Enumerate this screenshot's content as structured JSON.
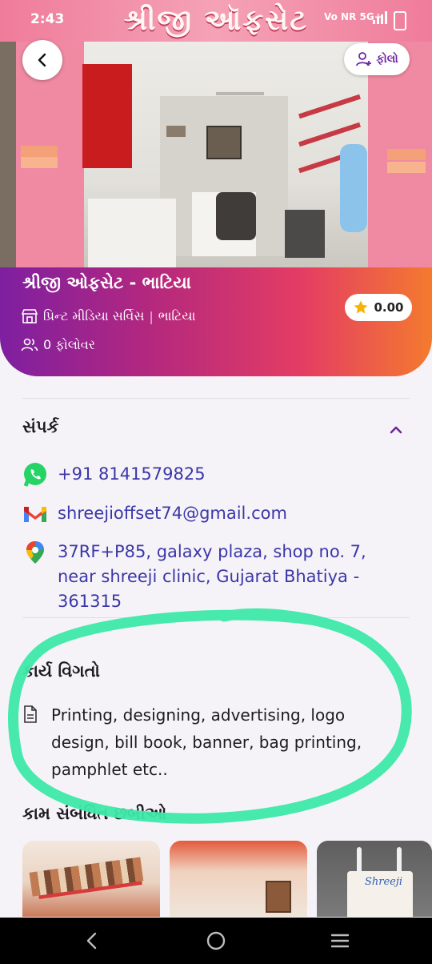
{
  "status_bar": {
    "time": "2:43",
    "network": "5G+",
    "carrier_labels": "Vo NR"
  },
  "hero": {
    "sign_text": "શ્રીજી ઑફસેટ",
    "follow_label": "ફોલો",
    "shop_name": "શ્રીજી ઓફસેટ - ભાટિયા",
    "category": "પ્રિન્ટ મીડિયા સર્વિસ",
    "location": "ભાટિયા",
    "followers": "0 ફોલોવર",
    "rating": "0.00"
  },
  "contact": {
    "title": "સંપર્ક",
    "phone": "+91 8141579825",
    "email": "shreejioffset74@gmail.com",
    "address_line1": "37RF+P85, galaxy plaza, shop no. 7,",
    "address_line2": "near shreeji clinic,  Gujarat Bhatiya -",
    "address_line3": "361315"
  },
  "work_details": {
    "title": "કાર્ય વિગતો",
    "description_line1": "Printing, designing, advertising, logo",
    "description_line2": "design, bill book, banner, bag printing,",
    "description_line3": "pamphlet etc.."
  },
  "gallery": {
    "title": "કામ સંબંધિત છબીઓ",
    "thumb3_label": "Shreeji"
  },
  "colors": {
    "primary_purple": "#7e1fa1",
    "accent_orange": "#f47a2e",
    "link_blue": "#3a37a8",
    "highlight_green": "#3de8a8"
  },
  "icons": {
    "back": "arrow-left-icon",
    "follow": "add-user-icon",
    "store": "store-icon",
    "followers": "users-icon",
    "star": "star-icon",
    "chevron": "chevron-up-icon",
    "whatsapp": "whatsapp-icon",
    "gmail": "gmail-icon",
    "maps": "map-pin-icon",
    "document": "document-icon"
  }
}
